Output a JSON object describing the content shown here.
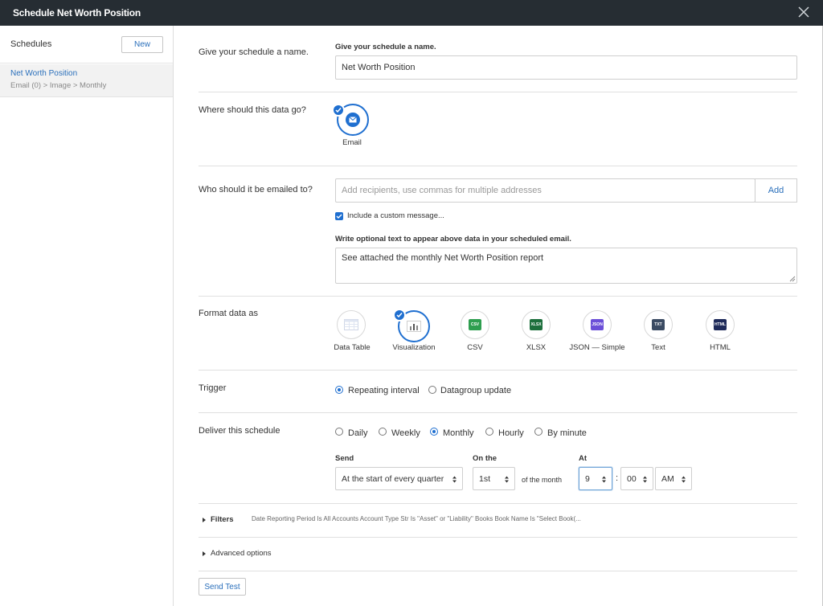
{
  "window": {
    "title": "Schedule Net Worth Position"
  },
  "sidebar": {
    "label": "Schedules",
    "new_button": "New",
    "items": [
      {
        "name": "Net Worth Position",
        "meta": "Email (0) > Image > Monthly"
      }
    ]
  },
  "name_section": {
    "label": "Give your schedule a name.",
    "field_caption": "Give your schedule a name.",
    "value": "Net Worth Position"
  },
  "destination_section": {
    "label": "Where should this data go?",
    "option": "Email"
  },
  "recipients_section": {
    "label": "Who should it be emailed to?",
    "placeholder": "Add recipients, use commas for multiple addresses",
    "add_button": "Add",
    "custom_message_checkbox": "Include a custom message...",
    "custom_message_caption": "Write optional text to appear above data in your scheduled email.",
    "custom_message_value": "See attached the monthly Net Worth Position report"
  },
  "format_section": {
    "label": "Format data as",
    "options": [
      {
        "label": "Data Table",
        "icon": "data-table-icon",
        "selected": false
      },
      {
        "label": "Visualization",
        "icon": "visualization-icon",
        "selected": true
      },
      {
        "label": "CSV",
        "icon": "csv-icon",
        "selected": false,
        "tag": "CSV",
        "color": "#2e9e4f"
      },
      {
        "label": "XLSX",
        "icon": "xlsx-icon",
        "selected": false,
        "tag": "XLSX",
        "color": "#1d6f3c"
      },
      {
        "label": "JSON — Simple",
        "icon": "json-icon",
        "selected": false,
        "tag": "JSON",
        "color": "#6b4fd8"
      },
      {
        "label": "Text",
        "icon": "text-icon",
        "selected": false,
        "tag": "TXT",
        "color": "#3b4b63"
      },
      {
        "label": "HTML",
        "icon": "html-icon",
        "selected": false,
        "tag": "HTML",
        "color": "#1e2a5a"
      }
    ]
  },
  "trigger_section": {
    "label": "Trigger",
    "options": [
      "Repeating interval",
      "Datagroup update"
    ],
    "selected": "Repeating interval"
  },
  "deliver_section": {
    "label": "Deliver this schedule",
    "options": [
      "Daily",
      "Weekly",
      "Monthly",
      "Hourly",
      "By minute"
    ],
    "selected": "Monthly",
    "send_caption": "Send",
    "send_value": "At the start of every quarter",
    "on_the_caption": "On the",
    "on_the_value": "1st",
    "of_the_month": "of the month",
    "at_caption": "At",
    "hour": "9",
    "separator": ":",
    "minute": "00",
    "ampm": "AM"
  },
  "filters": {
    "label": "Filters",
    "summary": "Date Reporting Period Is All Accounts Account Type Str Is \"Asset\" or \"Liability\" Books Book Name Is \"Select Book(..."
  },
  "advanced": {
    "label": "Advanced options"
  },
  "send_test_button": "Send Test",
  "colors": {
    "accent": "#1f6fd0",
    "titlebar": "#262d33",
    "link": "#2a6fbb"
  }
}
